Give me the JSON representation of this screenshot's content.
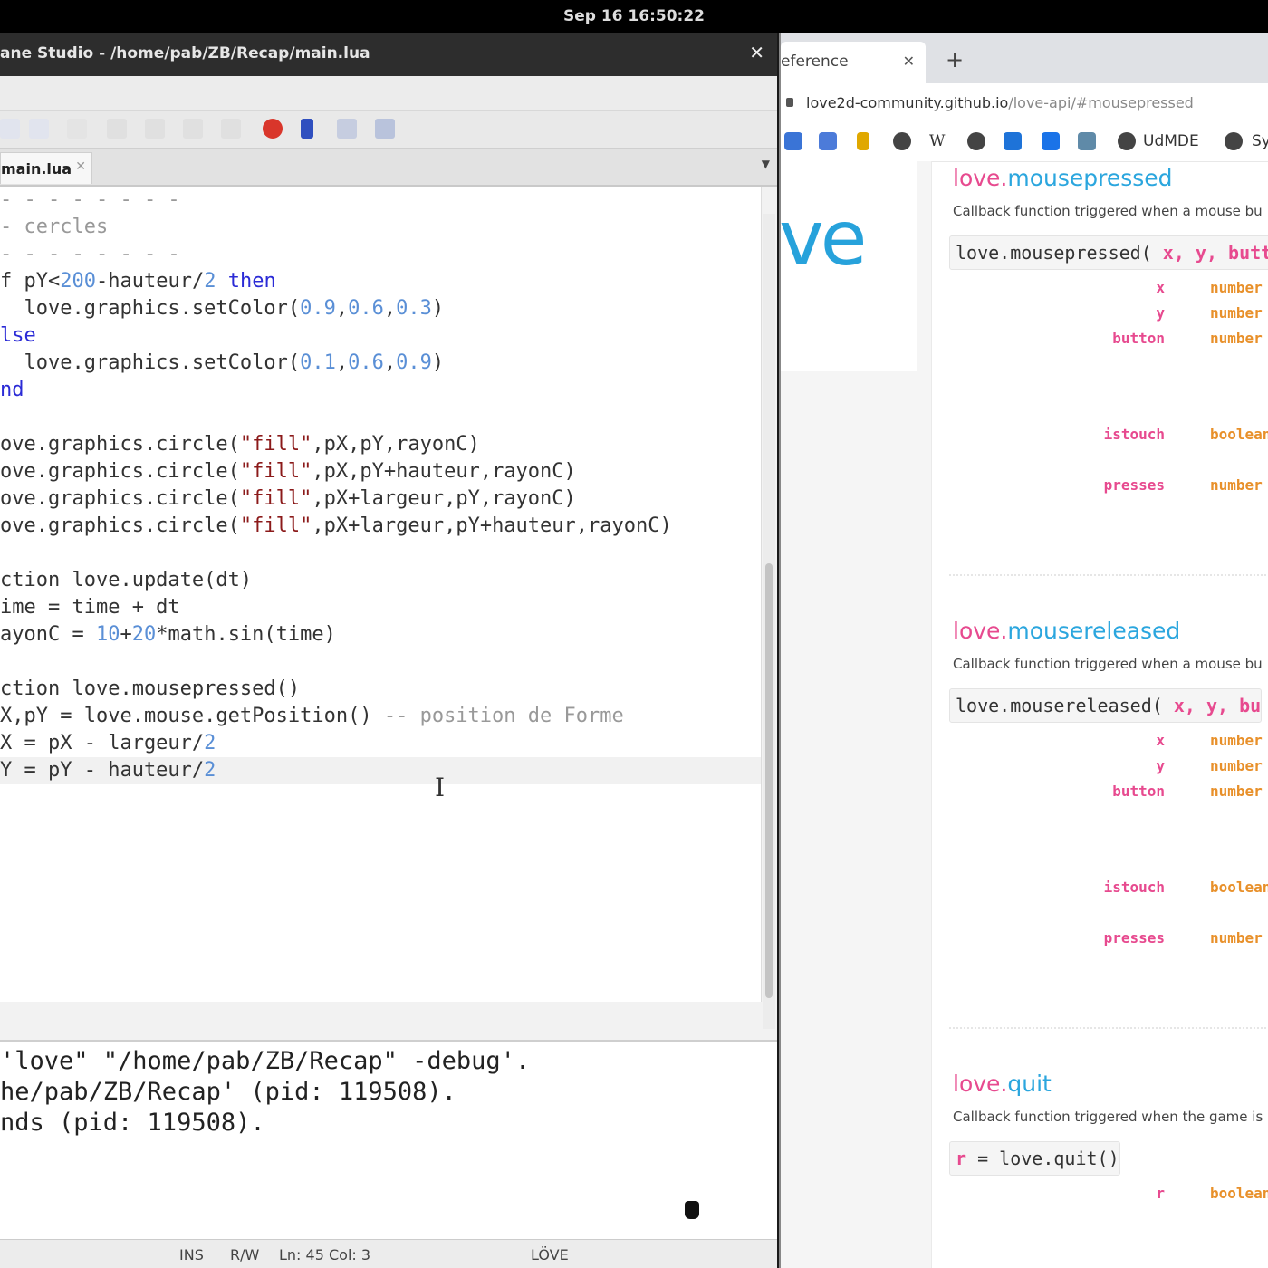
{
  "system": {
    "clock": "Sep 16  16:50:22"
  },
  "ide": {
    "title": "ane Studio - /home/pab/ZB/Recap/main.lua",
    "tab": "main.lua",
    "code": [
      {
        "t": "- - - - - - - -",
        "cls": "cm"
      },
      {
        "t": "- cercles",
        "cls": "cm"
      },
      {
        "t": "- - - - - - - -",
        "cls": "cm"
      },
      {
        "h": "f pY<200-hauteur/2 then"
      },
      {
        "h": "  love.graphics.setColor(0.9,0.6,0.3)"
      },
      {
        "h": "lse"
      },
      {
        "h": "  love.graphics.setColor(0.1,0.6,0.9)"
      },
      {
        "h": "nd"
      },
      {
        "h": ""
      },
      {
        "h": "ove.graphics.circle(\"fill\",pX,pY,rayonC)"
      },
      {
        "h": "ove.graphics.circle(\"fill\",pX,pY+hauteur,rayonC)"
      },
      {
        "h": "ove.graphics.circle(\"fill\",pX+largeur,pY,rayonC)"
      },
      {
        "h": "ove.graphics.circle(\"fill\",pX+largeur,pY+hauteur,rayonC)"
      },
      {
        "h": ""
      },
      {
        "h": "ction love.update(dt)"
      },
      {
        "h": "ime = time + dt"
      },
      {
        "h": "ayonC = 10+20*math.sin(time)"
      },
      {
        "h": ""
      },
      {
        "h": "ction love.mousepressed()"
      },
      {
        "h": "X,pY = love.mouse.getPosition() -- position de Forme"
      },
      {
        "h": "X = pX - largeur/2"
      },
      {
        "h": "Y = pY - hauteur/2"
      }
    ],
    "console": [
      "'love\" \"/home/pab/ZB/Recap\" -debug'.",
      "he/pab/ZB/Recap' (pid: 119508).",
      "nds (pid: 119508)."
    ],
    "status": {
      "ins": "INS",
      "rw": "R/W",
      "pos": "Ln: 45 Col: 3",
      "engine": "LÖVE"
    }
  },
  "browser": {
    "tab_title": "eference",
    "url_host": "love2d-community.github.io",
    "url_path": "/love-api/#mousepressed",
    "bookmark_label_1": "UdMDE",
    "bookmark_label_2": "Sy",
    "logo": "ve",
    "sections": [
      {
        "prefix": "love.",
        "name": "mousepressed",
        "desc": "Callback function triggered when a mouse bu",
        "sig_fn": "love.mousepressed( ",
        "sig_args": "x, y, butt",
        "params": [
          {
            "name": "x",
            "type": "number"
          },
          {
            "name": "y",
            "type": "number"
          },
          {
            "name": "button",
            "type": "number"
          },
          {
            "name": "istouch",
            "type": "boolean"
          },
          {
            "name": "presses",
            "type": "number"
          }
        ]
      },
      {
        "prefix": "love.",
        "name": "mousereleased",
        "desc": "Callback function triggered when a mouse bu",
        "sig_fn": "love.mousereleased( ",
        "sig_args": "x, y, bu",
        "params": [
          {
            "name": "x",
            "type": "number"
          },
          {
            "name": "y",
            "type": "number"
          },
          {
            "name": "button",
            "type": "number"
          },
          {
            "name": "istouch",
            "type": "boolean"
          },
          {
            "name": "presses",
            "type": "number"
          }
        ]
      },
      {
        "prefix": "love.",
        "name": "quit",
        "desc": "Callback function triggered when the game is",
        "sig_ret": "r",
        "sig_rest": " = love.quit()",
        "params": [
          {
            "name": "r",
            "type": "boolean"
          }
        ]
      }
    ]
  },
  "colors": {
    "pink": "#e74a8f",
    "blue": "#2ba6de",
    "orange": "#e8902a"
  }
}
